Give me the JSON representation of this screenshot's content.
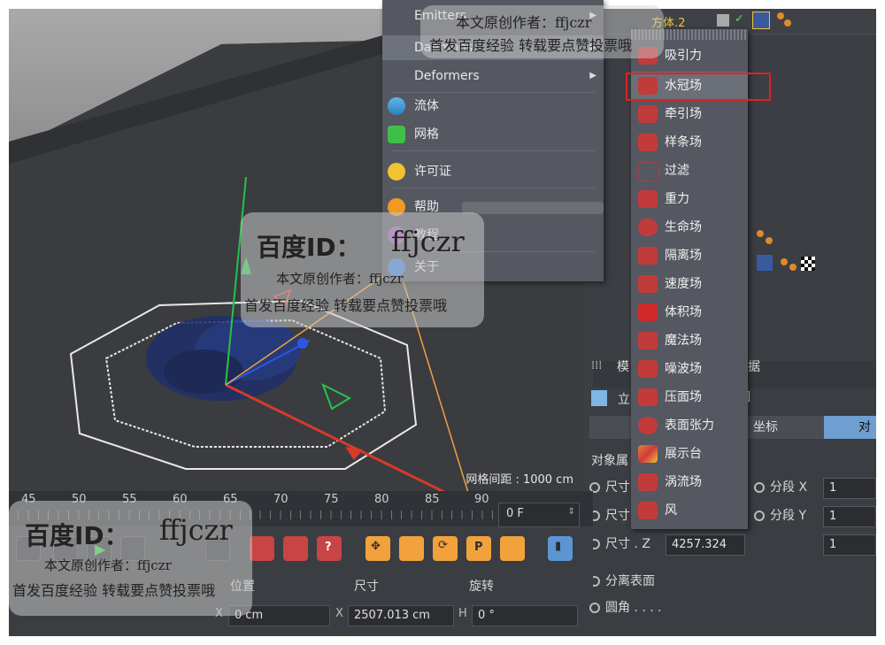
{
  "viewport": {
    "grid_spacing": "网格间距 : 1000 cm"
  },
  "object_manager": {
    "top_object_name": "方体.2"
  },
  "main_menu": {
    "items": [
      {
        "label": "Emitters",
        "has_submenu": true
      },
      {
        "label": "Daemons",
        "has_submenu": true
      },
      {
        "label": "Deformers",
        "has_submenu": true
      },
      {
        "label": "流体",
        "icon": "fluid-icon"
      },
      {
        "label": "网格",
        "icon": "mesh-icon"
      },
      {
        "label": "许可证",
        "icon": "license-icon"
      },
      {
        "label": "帮助",
        "icon": "help-icon"
      },
      {
        "label": "教程",
        "icon": "tutorial-icon"
      },
      {
        "label": "关于",
        "icon": "about-icon"
      }
    ]
  },
  "sub_menu": {
    "items": [
      {
        "label": "吸引力",
        "icon": "attractor-icon",
        "color": "#c23b3b"
      },
      {
        "label": "水冠场",
        "icon": "crown-icon",
        "color": "#c23b3b",
        "highlighted": true
      },
      {
        "label": "牵引场",
        "icon": "drag-icon",
        "color": "#c23b3b"
      },
      {
        "label": "样条场",
        "icon": "spline-icon",
        "color": "#c23b3b"
      },
      {
        "label": "过滤",
        "icon": "filter-icon",
        "color": "#c23b3b"
      },
      {
        "label": "重力",
        "icon": "gravity-icon",
        "color": "#c23b3b"
      },
      {
        "label": "生命场",
        "icon": "life-icon",
        "color": "#c23b3b"
      },
      {
        "label": "隔离场",
        "icon": "isolate-icon",
        "color": "#c23b3b"
      },
      {
        "label": "速度场",
        "icon": "velocity-icon",
        "color": "#c23b3b"
      },
      {
        "label": "体积场",
        "icon": "volume-icon",
        "color": "#c23b3b"
      },
      {
        "label": "魔法场",
        "icon": "magic-icon",
        "color": "#c23b3b"
      },
      {
        "label": "噪波场",
        "icon": "noise-icon",
        "color": "#c23b3b"
      },
      {
        "label": "压面场",
        "icon": "pressure-icon",
        "color": "#c23b3b"
      },
      {
        "label": "表面张力",
        "icon": "surface-tension-icon",
        "color": "#c23b3b"
      },
      {
        "label": "展示台",
        "icon": "showcase-icon",
        "color": "#e0803a"
      },
      {
        "label": "涡流场",
        "icon": "vortex-icon",
        "color": "#c23b3b"
      },
      {
        "label": "风",
        "icon": "wind-icon",
        "color": "#c23b3b"
      }
    ]
  },
  "timeline": {
    "ticks": [
      "45",
      "50",
      "55",
      "60",
      "65",
      "70",
      "75",
      "80",
      "85",
      "90"
    ],
    "current_frame": "0 F"
  },
  "coords": {
    "headers": {
      "position": "位置",
      "size": "尺寸",
      "rotation": "旋转"
    },
    "x_label": "X",
    "x_position": "0 cm",
    "x_size": "2507.013 cm",
    "h_label": "H",
    "h_rotation": "0 °"
  },
  "attributes": {
    "header_left": "模",
    "header_right": "据",
    "object_label": "立",
    "tab_coord": "坐标",
    "tab_object": "对",
    "section": "对象属",
    "size_x_label": "尺寸",
    "size_y_label": "尺寸",
    "size_z_label": "尺寸 . Z",
    "size_z_value": "4257.324",
    "seg_x_label": "分段 X",
    "seg_x_value": "1",
    "seg_y_label": "分段 Y",
    "seg_y_value": "1",
    "seg_z_value": "1",
    "separate_label": "分离表面",
    "fillet_label": "圆角 . . . ."
  },
  "watermark": {
    "brand": "百度ID：",
    "user": "ffjczr",
    "line1": "本文原创作者：ffjczr",
    "line2": "首发百度经验 转载要点赞投票哦"
  }
}
